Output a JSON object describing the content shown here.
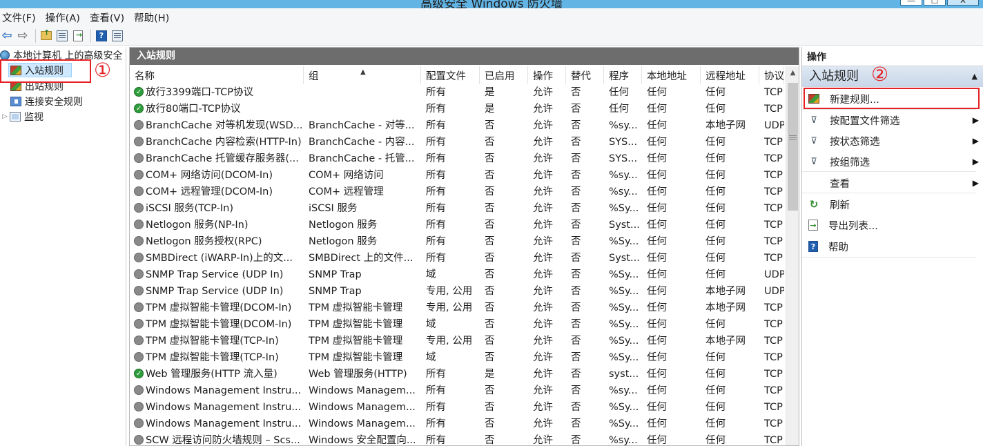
{
  "window": {
    "title": "高级安全 Windows 防火墙",
    "min_glyph": "—",
    "max_glyph": "☐",
    "close_glyph": "✕"
  },
  "menu": [
    "文件(F)",
    "操作(A)",
    "查看(V)",
    "帮助(H)"
  ],
  "toolbar": {
    "back_glyph": "⇦",
    "forward_glyph": "⇨",
    "help_glyph": "?"
  },
  "tree": {
    "root": "本地计算机 上的高级安全",
    "items": [
      "入站规则",
      "出站规则",
      "连接安全规则",
      "监视"
    ],
    "expander_glyph": "▷"
  },
  "annotations": {
    "one": "①",
    "two": "②",
    "accent": "#e52125"
  },
  "panel": {
    "title": "入站规则",
    "columns": [
      "名称",
      "组",
      "配置文件",
      "已启用",
      "操作",
      "替代",
      "程序",
      "本地地址",
      "远程地址",
      "协议"
    ],
    "sort_glyph": "▲",
    "scroll_up_glyph": "▲",
    "rows": [
      {
        "enabled": true,
        "name": "放行3399端口-TCP协议",
        "group": "",
        "profile": "所有",
        "on": "是",
        "action": "允许",
        "override": "否",
        "program": "任何",
        "local": "任何",
        "remote": "任何",
        "proto": "TCP"
      },
      {
        "enabled": true,
        "name": "放行80端口-TCP协议",
        "group": "",
        "profile": "所有",
        "on": "是",
        "action": "允许",
        "override": "否",
        "program": "任何",
        "local": "任何",
        "remote": "任何",
        "proto": "TCP"
      },
      {
        "enabled": false,
        "name": "BranchCache 对等机发现(WSD...",
        "group": "BranchCache - 对等...",
        "profile": "所有",
        "on": "否",
        "action": "允许",
        "override": "否",
        "program": "%sy...",
        "local": "任何",
        "remote": "本地子网",
        "proto": "UDP"
      },
      {
        "enabled": false,
        "name": "BranchCache 内容检索(HTTP-In)",
        "group": "BranchCache - 内容...",
        "profile": "所有",
        "on": "否",
        "action": "允许",
        "override": "否",
        "program": "SYS...",
        "local": "任何",
        "remote": "任何",
        "proto": "TCP"
      },
      {
        "enabled": false,
        "name": "BranchCache 托管缓存服务器(...",
        "group": "BranchCache - 托管...",
        "profile": "所有",
        "on": "否",
        "action": "允许",
        "override": "否",
        "program": "SYS...",
        "local": "任何",
        "remote": "任何",
        "proto": "TCP"
      },
      {
        "enabled": false,
        "name": "COM+ 网络访问(DCOM-In)",
        "group": "COM+ 网络访问",
        "profile": "所有",
        "on": "否",
        "action": "允许",
        "override": "否",
        "program": "%sy...",
        "local": "任何",
        "remote": "任何",
        "proto": "TCP"
      },
      {
        "enabled": false,
        "name": "COM+ 远程管理(DCOM-In)",
        "group": "COM+ 远程管理",
        "profile": "所有",
        "on": "否",
        "action": "允许",
        "override": "否",
        "program": "%sy...",
        "local": "任何",
        "remote": "任何",
        "proto": "TCP"
      },
      {
        "enabled": false,
        "name": "iSCSI 服务(TCP-In)",
        "group": "iSCSI 服务",
        "profile": "所有",
        "on": "否",
        "action": "允许",
        "override": "否",
        "program": "%Sy...",
        "local": "任何",
        "remote": "任何",
        "proto": "TCP"
      },
      {
        "enabled": false,
        "name": "Netlogon 服务(NP-In)",
        "group": "Netlogon 服务",
        "profile": "所有",
        "on": "否",
        "action": "允许",
        "override": "否",
        "program": "Syst...",
        "local": "任何",
        "remote": "任何",
        "proto": "TCP"
      },
      {
        "enabled": false,
        "name": "Netlogon 服务授权(RPC)",
        "group": "Netlogon 服务",
        "profile": "所有",
        "on": "否",
        "action": "允许",
        "override": "否",
        "program": "%Sy...",
        "local": "任何",
        "remote": "任何",
        "proto": "TCP"
      },
      {
        "enabled": false,
        "name": "SMBDirect (iWARP-In)上的文...",
        "group": "SMBDirect 上的文件...",
        "profile": "所有",
        "on": "否",
        "action": "允许",
        "override": "否",
        "program": "Syst...",
        "local": "任何",
        "remote": "任何",
        "proto": "TCP"
      },
      {
        "enabled": false,
        "name": "SNMP Trap Service (UDP In)",
        "group": "SNMP Trap",
        "profile": "域",
        "on": "否",
        "action": "允许",
        "override": "否",
        "program": "%Sy...",
        "local": "任何",
        "remote": "任何",
        "proto": "UDP"
      },
      {
        "enabled": false,
        "name": "SNMP Trap Service (UDP In)",
        "group": "SNMP Trap",
        "profile": "专用, 公用",
        "on": "否",
        "action": "允许",
        "override": "否",
        "program": "%Sy...",
        "local": "任何",
        "remote": "本地子网",
        "proto": "UDP"
      },
      {
        "enabled": false,
        "name": "TPM 虚拟智能卡管理(DCOM-In)",
        "group": "TPM 虚拟智能卡管理",
        "profile": "专用, 公用",
        "on": "否",
        "action": "允许",
        "override": "否",
        "program": "%Sy...",
        "local": "任何",
        "remote": "本地子网",
        "proto": "TCP"
      },
      {
        "enabled": false,
        "name": "TPM 虚拟智能卡管理(DCOM-In)",
        "group": "TPM 虚拟智能卡管理",
        "profile": "域",
        "on": "否",
        "action": "允许",
        "override": "否",
        "program": "%Sy...",
        "local": "任何",
        "remote": "任何",
        "proto": "TCP"
      },
      {
        "enabled": false,
        "name": "TPM 虚拟智能卡管理(TCP-In)",
        "group": "TPM 虚拟智能卡管理",
        "profile": "专用, 公用",
        "on": "否",
        "action": "允许",
        "override": "否",
        "program": "%Sy...",
        "local": "任何",
        "remote": "本地子网",
        "proto": "TCP"
      },
      {
        "enabled": false,
        "name": "TPM 虚拟智能卡管理(TCP-In)",
        "group": "TPM 虚拟智能卡管理",
        "profile": "域",
        "on": "否",
        "action": "允许",
        "override": "否",
        "program": "%Sy...",
        "local": "任何",
        "remote": "任何",
        "proto": "TCP"
      },
      {
        "enabled": true,
        "name": "Web 管理服务(HTTP 流入量)",
        "group": "Web 管理服务(HTTP)",
        "profile": "所有",
        "on": "是",
        "action": "允许",
        "override": "否",
        "program": "syst...",
        "local": "任何",
        "remote": "任何",
        "proto": "TCP"
      },
      {
        "enabled": false,
        "name": "Windows Management Instru...",
        "group": "Windows Managem...",
        "profile": "所有",
        "on": "否",
        "action": "允许",
        "override": "否",
        "program": "%sy...",
        "local": "任何",
        "remote": "任何",
        "proto": "TCP"
      },
      {
        "enabled": false,
        "name": "Windows Management Instru...",
        "group": "Windows Managem...",
        "profile": "所有",
        "on": "否",
        "action": "允许",
        "override": "否",
        "program": "%Sy...",
        "local": "任何",
        "remote": "任何",
        "proto": "TCP"
      },
      {
        "enabled": false,
        "name": "Windows Management Instru...",
        "group": "Windows Managem...",
        "profile": "所有",
        "on": "否",
        "action": "允许",
        "override": "否",
        "program": "%Sy...",
        "local": "任何",
        "remote": "任何",
        "proto": "TCP"
      },
      {
        "enabled": false,
        "name": "SCW 远程访问防火墙规则 – Scs...",
        "group": "Windows 安全配置向...",
        "profile": "所有",
        "on": "否",
        "action": "允许",
        "override": "否",
        "program": "%sy...",
        "local": "任何",
        "remote": "任何",
        "proto": "TCP"
      }
    ]
  },
  "actions": {
    "title": "操作",
    "section": "入站规则",
    "collapse_glyph": "▲",
    "submenu_glyph": "▶",
    "items": [
      {
        "label": "新建规则...",
        "icon": "new-rule-icon",
        "submenu": false
      },
      {
        "label": "按配置文件筛选",
        "icon": "filter-icon",
        "submenu": true
      },
      {
        "label": "按状态筛选",
        "icon": "filter-icon",
        "submenu": true
      },
      {
        "label": "按组筛选",
        "icon": "filter-icon",
        "submenu": true
      },
      {
        "label": "查看",
        "icon": "",
        "submenu": true
      },
      {
        "label": "刷新",
        "icon": "refresh-icon",
        "submenu": false
      },
      {
        "label": "导出列表...",
        "icon": "export-list-icon",
        "submenu": false
      },
      {
        "label": "帮助",
        "icon": "help-icon",
        "submenu": false
      }
    ],
    "filter_glyph": "⊽",
    "refresh_glyph": "↻",
    "export_glyph": "→",
    "help_glyph": "?"
  }
}
